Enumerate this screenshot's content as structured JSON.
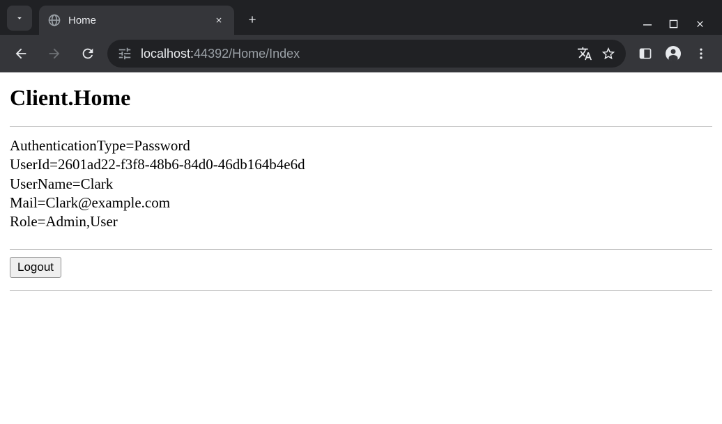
{
  "browser": {
    "tab_title": "Home",
    "url_host": "localhost:",
    "url_port": "44392",
    "url_path": "/Home/Index"
  },
  "page": {
    "heading": "Client.Home",
    "claims": {
      "auth_type_label": "AuthenticationType",
      "auth_type_value": "Password",
      "userid_label": "UserId",
      "userid_value": "2601ad22-f3f8-48b6-84d0-46db164b4e6d",
      "username_label": "UserName",
      "username_value": "Clark",
      "mail_label": "Mail",
      "mail_value": "Clark@example.com",
      "role_label": "Role",
      "role_value": "Admin,User"
    },
    "logout_label": "Logout"
  }
}
